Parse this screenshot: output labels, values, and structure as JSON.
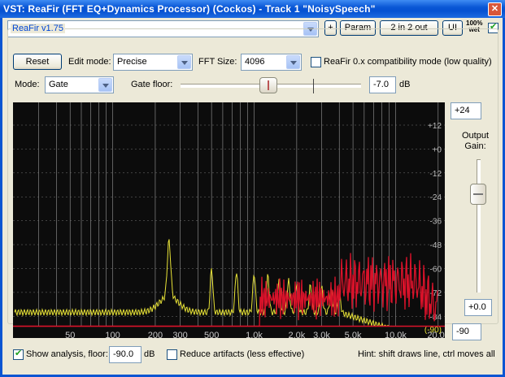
{
  "titlebar": {
    "title": "VST: ReaFir (FFT EQ+Dynamics Processor) (Cockos) - Track 1 \"NoisySpeech\"",
    "close_glyph": "✕"
  },
  "toolbar": {
    "preset_value": "",
    "plus_label": "+",
    "param_label": "Param",
    "routing_label": "2 in 2 out",
    "ui_label": "UI",
    "wet_label_top": "100%",
    "wet_label_bottom": "wet",
    "wet_checked": true
  },
  "plugin": {
    "version_label": "ReaFir v1.75",
    "reset_label": "Reset",
    "edit_mode_label": "Edit mode:",
    "edit_mode_value": "Precise",
    "fft_size_label": "FFT Size:",
    "fft_size_value": "4096",
    "compat_label": "ReaFir 0.x compatibility mode (low quality)",
    "compat_checked": false,
    "mode_label": "Mode:",
    "mode_value": "Gate",
    "gate_floor_label": "Gate floor:",
    "gate_floor_value": "-7.0",
    "gate_floor_unit": "dB",
    "gate_floor_slider_fraction": 0.5
  },
  "output": {
    "label": "Output\nGain:",
    "max_value": "+24",
    "current_value": "+0.0",
    "min_value": "-90",
    "slider_fraction": 0.25
  },
  "graph": {
    "db_labels": [
      "+12",
      "+0",
      "-12",
      "-24",
      "-36",
      "-48",
      "-60",
      "-72",
      "-84"
    ],
    "minus90_label": "(-90)",
    "freq_labels": [
      "50",
      "100",
      "200",
      "300",
      "500",
      "1.0k",
      "2.0k",
      "3.0k",
      "5.0k",
      "10.0k",
      "20.0k"
    ],
    "colors": {
      "analysis": "#e8e337",
      "gate": "#d9122a",
      "background": "#0c0c0c",
      "grid": "#cfcfcf"
    }
  },
  "footer": {
    "show_analysis_label": "Show analysis, floor:",
    "show_analysis_checked": true,
    "floor_value": "-90.0",
    "floor_unit": "dB",
    "reduce_label": "Reduce artifacts (less effective)",
    "reduce_checked": false,
    "hint": "Hint: shift draws line, ctrl moves all"
  }
}
